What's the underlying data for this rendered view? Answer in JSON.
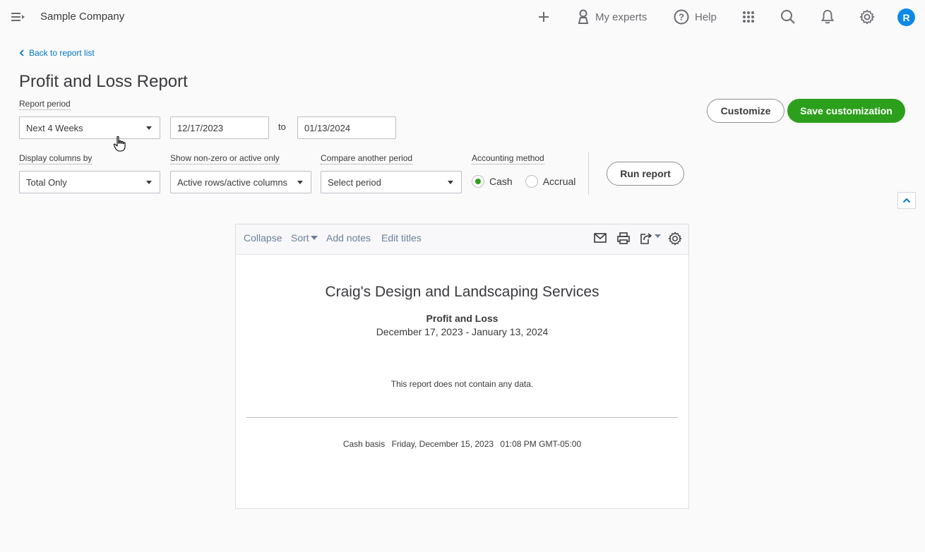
{
  "topbar": {
    "company_name": "Sample Company",
    "add_icon": "plus-icon",
    "experts_label": "My experts",
    "help_label": "Help",
    "apps_icon": "grid-icon",
    "search_icon": "search-icon",
    "notifications_icon": "bell-icon",
    "settings_icon": "gear-icon",
    "avatar_initial": "R",
    "avatar_color": "#0d8ae6"
  },
  "header": {
    "back_link": "Back to report list",
    "title": "Profit and Loss Report"
  },
  "filters": {
    "report_period_label": "Report period",
    "report_period_value": "Next 4 Weeks",
    "start_date": "12/17/2023",
    "to_label": "to",
    "end_date": "01/13/2024",
    "display_columns_label": "Display columns by",
    "display_columns_value": "Total Only",
    "show_nonzero_label": "Show non-zero or active only",
    "show_nonzero_value": "Active rows/active columns",
    "compare_label": "Compare another period",
    "compare_value": "Select period",
    "accounting_method_label": "Accounting method",
    "accounting_options": [
      {
        "label": "Cash",
        "checked": true
      },
      {
        "label": "Accrual",
        "checked": false
      }
    ],
    "run_report_label": "Run report"
  },
  "actions": {
    "customize_label": "Customize",
    "save_customization_label": "Save customization",
    "accent_color": "#2ca01c"
  },
  "report": {
    "toolbar": {
      "collapse": "Collapse",
      "sort": "Sort",
      "add_notes": "Add notes",
      "edit_titles": "Edit titles"
    },
    "company_title": "Craig's Design and Landscaping Services",
    "report_name": "Profit and Loss",
    "date_range": "December 17, 2023 - January 13, 2024",
    "empty_message": "This report does not contain any data.",
    "footer": {
      "basis": "Cash basis",
      "timestamp_date": "Friday, December 15, 2023",
      "timestamp_time": "01:08 PM GMT-05:00"
    }
  }
}
